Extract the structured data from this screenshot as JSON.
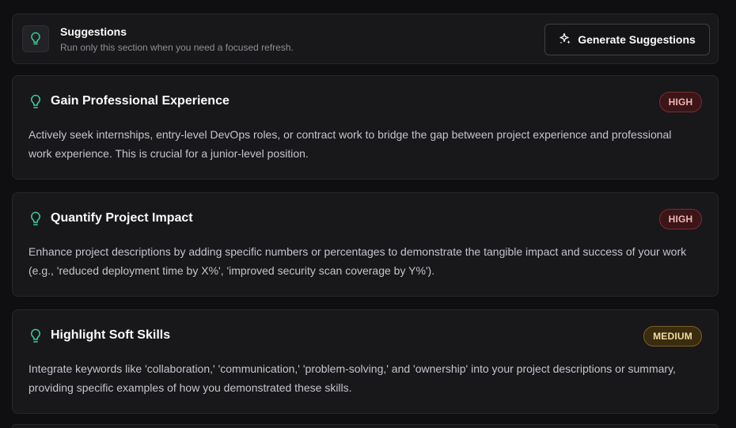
{
  "header": {
    "icon": "lightbulb-icon",
    "title": "Suggestions",
    "subtitle": "Run only this section when you need a focused refresh.",
    "button_icon": "sparkles-icon",
    "button_label": "Generate Suggestions"
  },
  "colors": {
    "accent_icon": "#34d399",
    "high_badge_bg": "#3b1518",
    "high_badge_text": "#f3b4b4",
    "medium_badge_bg": "#3a2c0f",
    "medium_badge_text": "#f3dca0"
  },
  "suggestions": [
    {
      "icon": "lightbulb-icon",
      "title": "Gain Professional Experience",
      "priority": "HIGH",
      "description": "Actively seek internships, entry-level DevOps roles, or contract work to bridge the gap between project experience and professional work experience. This is crucial for a junior-level position."
    },
    {
      "icon": "lightbulb-icon",
      "title": "Quantify Project Impact",
      "priority": "HIGH",
      "description": "Enhance project descriptions by adding specific numbers or percentages to demonstrate the tangible impact and success of your work (e.g., 'reduced deployment time by X%', 'improved security scan coverage by Y%')."
    },
    {
      "icon": "lightbulb-icon",
      "title": "Highlight Soft Skills",
      "priority": "MEDIUM",
      "description": "Integrate keywords like 'collaboration,' 'communication,' 'problem-solving,' and 'ownership' into your project descriptions or summary, providing specific examples of how you demonstrated these skills."
    }
  ]
}
